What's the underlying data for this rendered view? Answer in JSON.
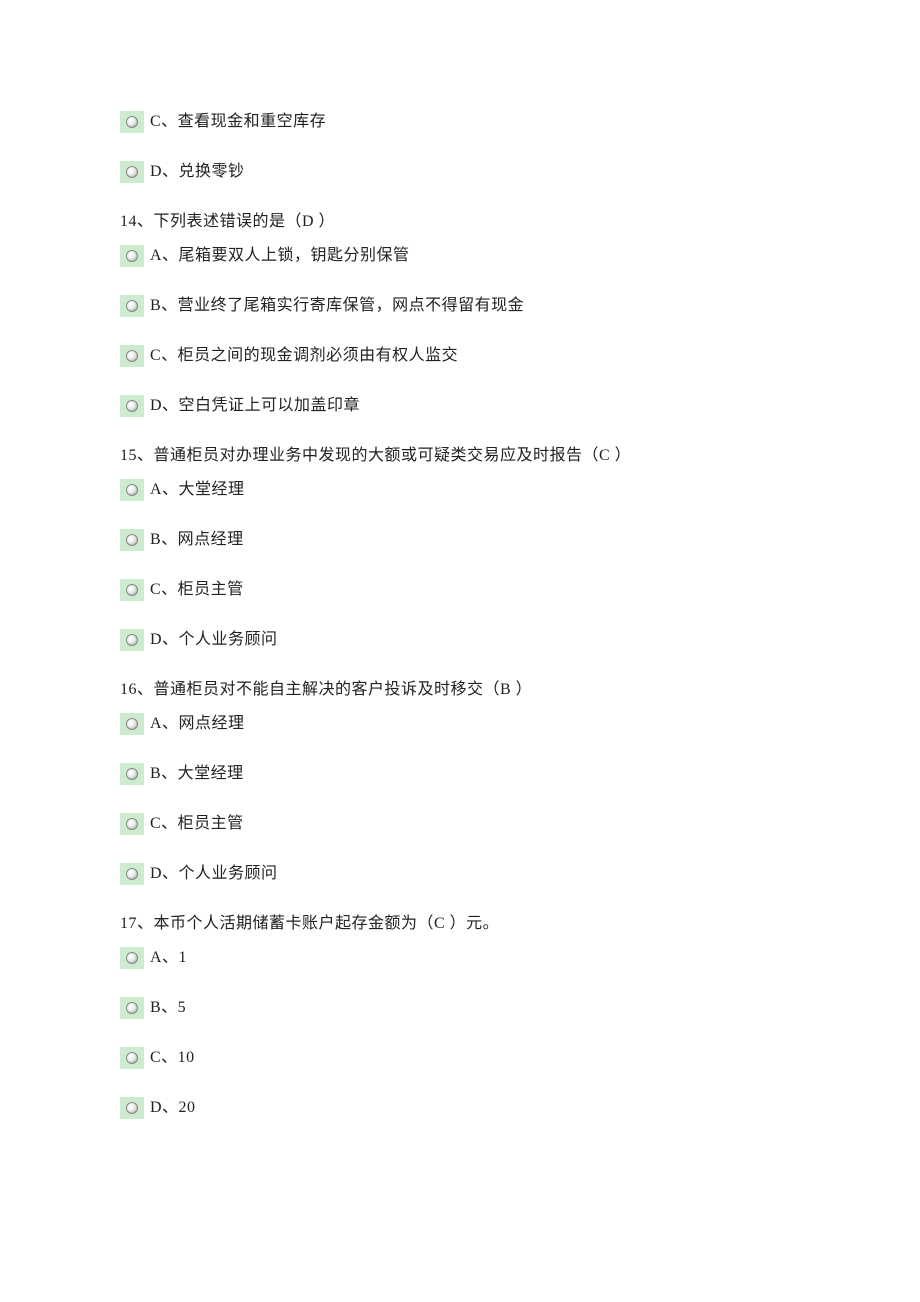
{
  "orphan_options": [
    {
      "label": "C、查看现金和重空库存"
    },
    {
      "label": "D、兑换零钞"
    }
  ],
  "questions": [
    {
      "prompt": "14、下列表述错误的是（D ）",
      "options": [
        {
          "label": "A、尾箱要双人上锁，钥匙分别保管"
        },
        {
          "label": "B、营业终了尾箱实行寄库保管，网点不得留有现金"
        },
        {
          "label": "C、柜员之间的现金调剂必须由有权人监交"
        },
        {
          "label": "D、空白凭证上可以加盖印章"
        }
      ]
    },
    {
      "prompt": "15、普通柜员对办理业务中发现的大额或可疑类交易应及时报告（C ）",
      "options": [
        {
          "label": "A、大堂经理"
        },
        {
          "label": "B、网点经理"
        },
        {
          "label": "C、柜员主管"
        },
        {
          "label": "D、个人业务顾问"
        }
      ]
    },
    {
      "prompt": "16、普通柜员对不能自主解决的客户投诉及时移交（B ）",
      "options": [
        {
          "label": "A、网点经理"
        },
        {
          "label": "B、大堂经理"
        },
        {
          "label": "C、柜员主管"
        },
        {
          "label": "D、个人业务顾问"
        }
      ]
    },
    {
      "prompt": "17、本币个人活期储蓄卡账户起存金额为（C ）元。",
      "options": [
        {
          "label": "A、1"
        },
        {
          "label": "B、5"
        },
        {
          "label": "C、10"
        },
        {
          "label": "D、20"
        }
      ]
    }
  ]
}
